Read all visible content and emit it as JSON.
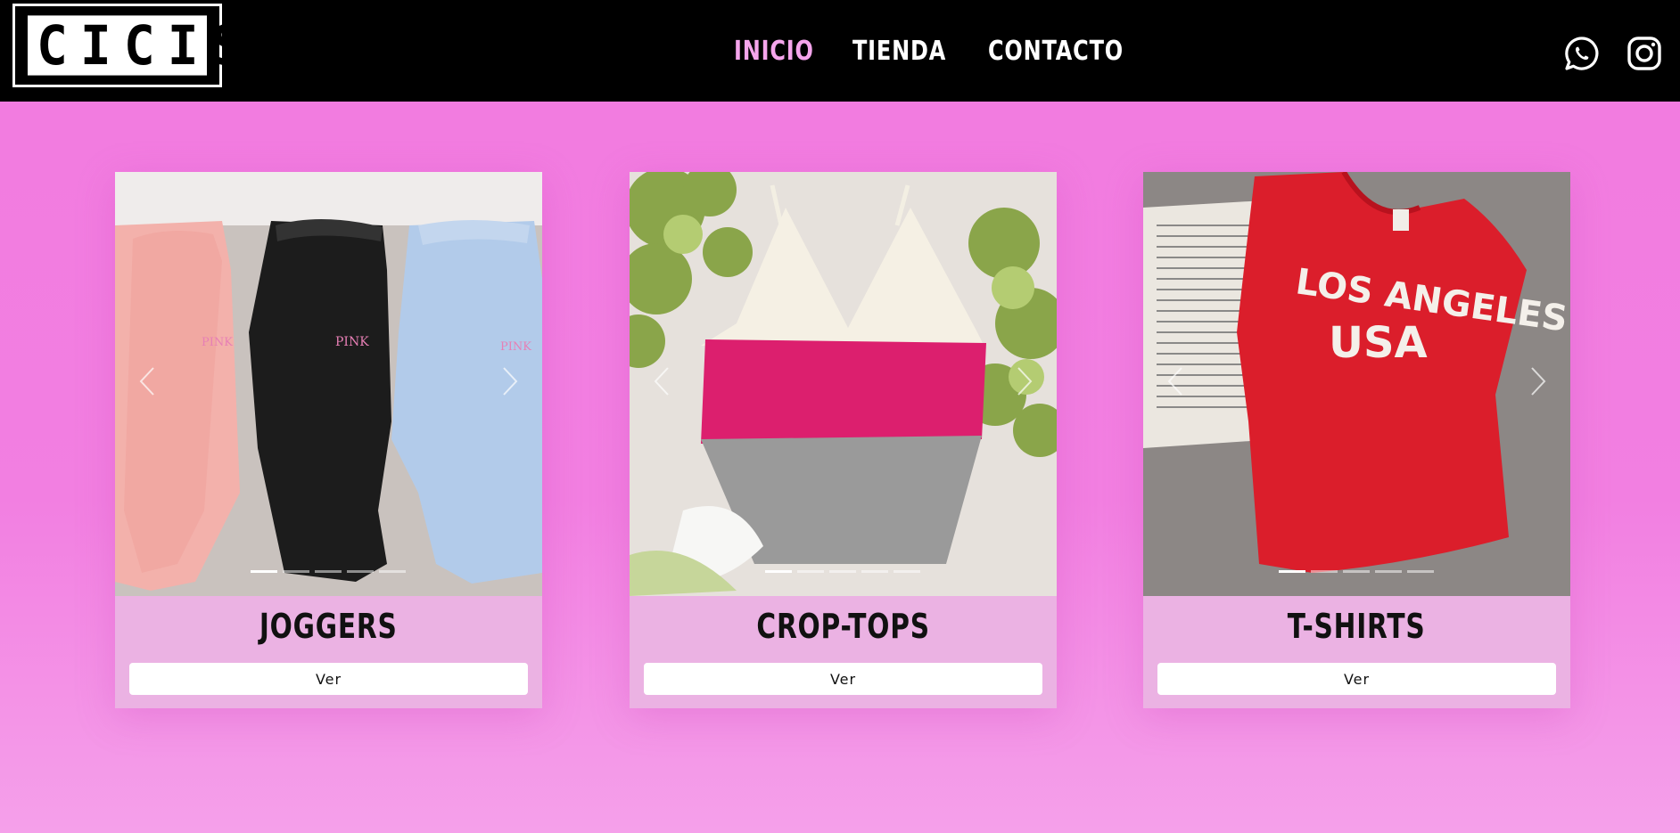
{
  "header": {
    "logo_text": "CICIS",
    "nav": [
      {
        "label": "INICIO",
        "active": true
      },
      {
        "label": "TIENDA",
        "active": false
      },
      {
        "label": "CONTACTO",
        "active": false
      }
    ],
    "social": [
      "whatsapp-icon",
      "instagram-icon"
    ]
  },
  "colors": {
    "background": "#f27be0",
    "header": "#000000",
    "nav_active": "#f5a5ec",
    "card_footer": "#ebb2e3"
  },
  "cards": [
    {
      "title": "JOGGERS",
      "button": "Ver",
      "slides": 5,
      "active_slide": 1
    },
    {
      "title": "CROP-TOPS",
      "button": "Ver",
      "slides": 5,
      "active_slide": 1
    },
    {
      "title": "T-SHIRTS",
      "button": "Ver",
      "slides": 5,
      "active_slide": 1
    }
  ]
}
